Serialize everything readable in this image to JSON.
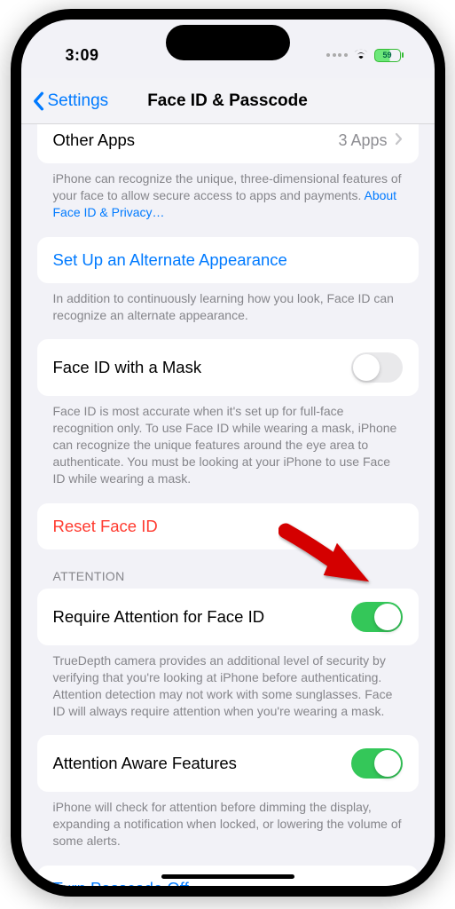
{
  "status": {
    "time": "3:09",
    "battery": "59"
  },
  "nav": {
    "back": "Settings",
    "title": "Face ID & Passcode"
  },
  "otherApps": {
    "label": "Other Apps",
    "value": "3 Apps"
  },
  "footers": {
    "aboutFaceId": "iPhone can recognize the unique, three-dimensional features of your face to allow secure access to apps and payments. ",
    "aboutFaceIdLink": "About Face ID & Privacy…",
    "alternate": "In addition to continuously learning how you look, Face ID can recognize an alternate appearance.",
    "mask": "Face ID is most accurate when it's set up for full-face recognition only. To use Face ID while wearing a mask, iPhone can recognize the unique features around the eye area to authenticate. You must be looking at your iPhone to use Face ID while wearing a mask.",
    "requireAttention": "TrueDepth camera provides an additional level of security by verifying that you're looking at iPhone before authenticating. Attention detection may not work with some sunglasses. Face ID will always require attention when you're wearing a mask.",
    "attentionAware": "iPhone will check for attention before dimming the display, expanding a notification when locked, or lowering the volume of some alerts."
  },
  "cells": {
    "alternate": "Set Up an Alternate Appearance",
    "mask": "Face ID with a Mask",
    "reset": "Reset Face ID",
    "attentionHeader": "ATTENTION",
    "requireAttention": "Require Attention for Face ID",
    "attentionAware": "Attention Aware Features",
    "passcodeOff": "Turn Passcode Off"
  }
}
